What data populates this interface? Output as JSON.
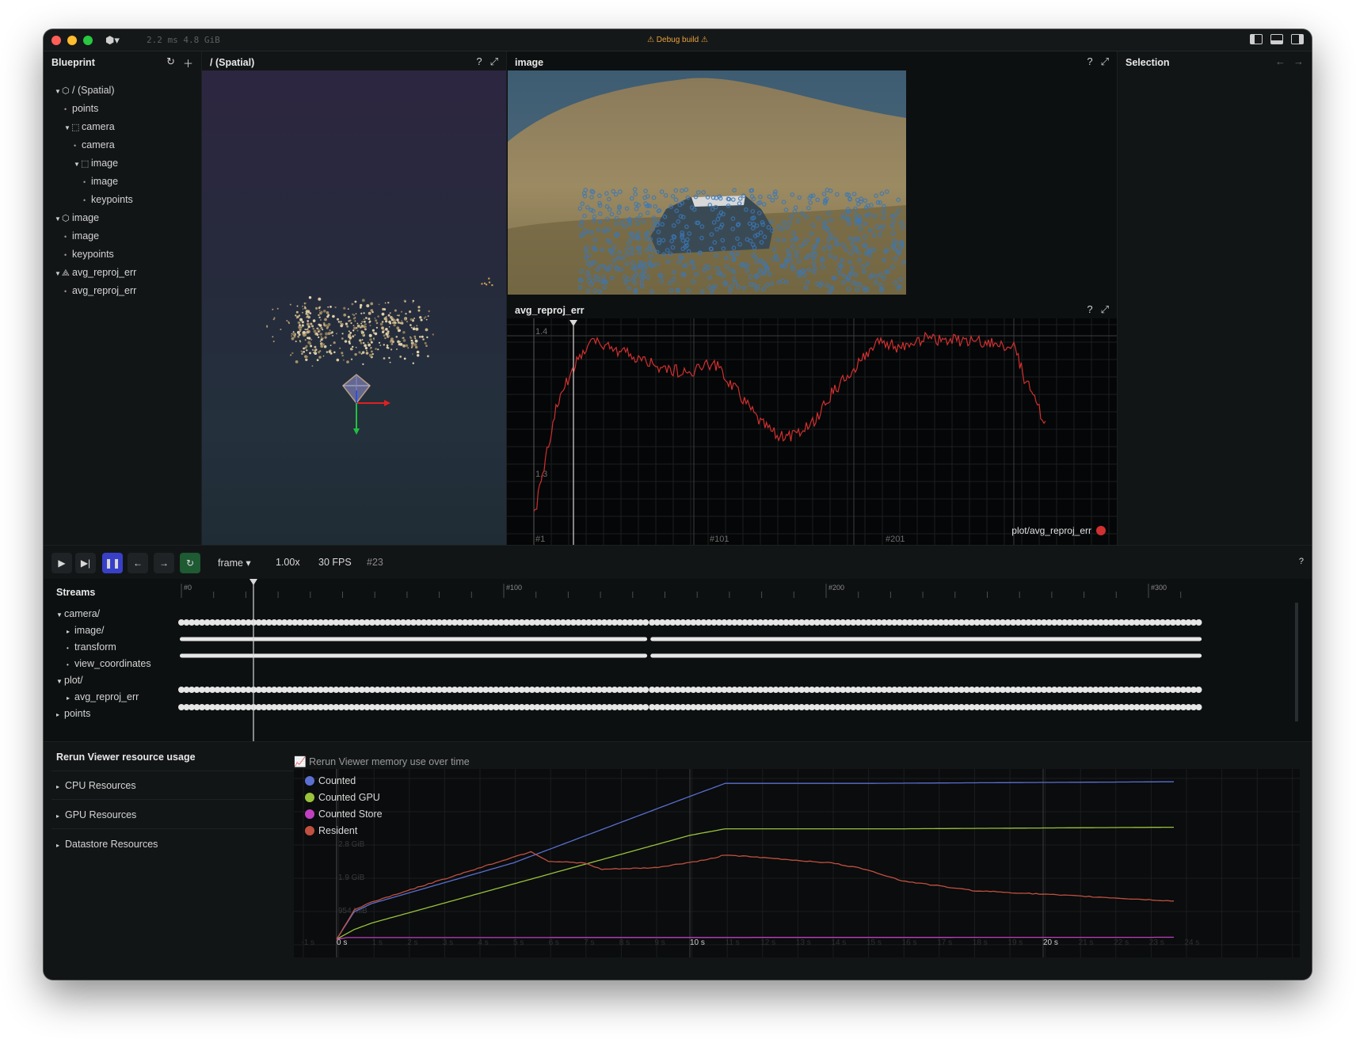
{
  "titlebar": {
    "perf": "2.2 ms  4.8 GiB",
    "debug_label": "⚠ Debug build ⚠"
  },
  "blueprint": {
    "title": "Blueprint",
    "tree": [
      {
        "label": "/ (Spatial)",
        "depth": 0,
        "kind": "space3d",
        "expanded": true
      },
      {
        "label": "points",
        "depth": 1,
        "kind": "entity"
      },
      {
        "label": "camera",
        "depth": 1,
        "kind": "group",
        "expanded": true
      },
      {
        "label": "camera",
        "depth": 2,
        "kind": "entity"
      },
      {
        "label": "image",
        "depth": 2,
        "kind": "group",
        "expanded": true
      },
      {
        "label": "image",
        "depth": 3,
        "kind": "entity"
      },
      {
        "label": "keypoints",
        "depth": 3,
        "kind": "entity"
      },
      {
        "label": "image",
        "depth": 0,
        "kind": "space3d",
        "expanded": true
      },
      {
        "label": "image",
        "depth": 1,
        "kind": "entity"
      },
      {
        "label": "keypoints",
        "depth": 1,
        "kind": "entity"
      },
      {
        "label": "avg_reproj_err",
        "depth": 0,
        "kind": "timeseries",
        "expanded": true
      },
      {
        "label": "avg_reproj_err",
        "depth": 1,
        "kind": "entity"
      }
    ]
  },
  "spatial": {
    "title": "/ (Spatial)"
  },
  "image_view": {
    "title": "image"
  },
  "plot_view": {
    "title": "avg_reproj_err",
    "legend": "plot/avg_reproj_err",
    "series_color": "#d03030",
    "y_ticks": [
      "1.4",
      "1.3"
    ],
    "x_ticks": [
      "#1",
      "#101",
      "#201"
    ]
  },
  "selection": {
    "title": "Selection"
  },
  "timebar": {
    "timeline": "frame",
    "speed": "1.00x",
    "fps": "30 FPS",
    "current_frame": "#23",
    "help": "?"
  },
  "streams": {
    "title": "Streams",
    "ticks": [
      "#0",
      "#100",
      "#200",
      "#300"
    ],
    "rows": [
      {
        "label": "camera/",
        "depth": 0,
        "arrow": "▼"
      },
      {
        "label": "image/",
        "depth": 1,
        "arrow": "▸"
      },
      {
        "label": "transform",
        "depth": 1,
        "arrow": "•"
      },
      {
        "label": "view_coordinates",
        "depth": 1,
        "arrow": "•"
      },
      {
        "label": "plot/",
        "depth": 0,
        "arrow": "▼"
      },
      {
        "label": "avg_reproj_err",
        "depth": 1,
        "arrow": "▸"
      },
      {
        "label": "points",
        "depth": 0,
        "arrow": "▸"
      }
    ]
  },
  "resources": {
    "title": "Rerun Viewer resource usage",
    "items": [
      "CPU Resources",
      "GPU Resources",
      "Datastore Resources"
    ],
    "chart_title": "Rerun Viewer memory use over time",
    "legend": [
      {
        "name": "Counted",
        "color": "#5a6fd0"
      },
      {
        "name": "Counted GPU",
        "color": "#9ac23c"
      },
      {
        "name": "Counted Store",
        "color": "#c040c0"
      },
      {
        "name": "Resident",
        "color": "#c05040"
      }
    ],
    "y_ticks": [
      "2.8 GiB",
      "1.9 GiB",
      "954 MiB"
    ],
    "x_ticks": [
      "-1 s",
      "0 s",
      "1 s",
      "2 s",
      "3 s",
      "4 s",
      "5 s",
      "6 s",
      "7 s",
      "8 s",
      "9 s",
      "10 s",
      "11 s",
      "12 s",
      "13 s",
      "14 s",
      "15 s",
      "16 s",
      "17 s",
      "18 s",
      "19 s",
      "20 s",
      "21 s",
      "22 s",
      "23 s",
      "24 s"
    ]
  }
}
